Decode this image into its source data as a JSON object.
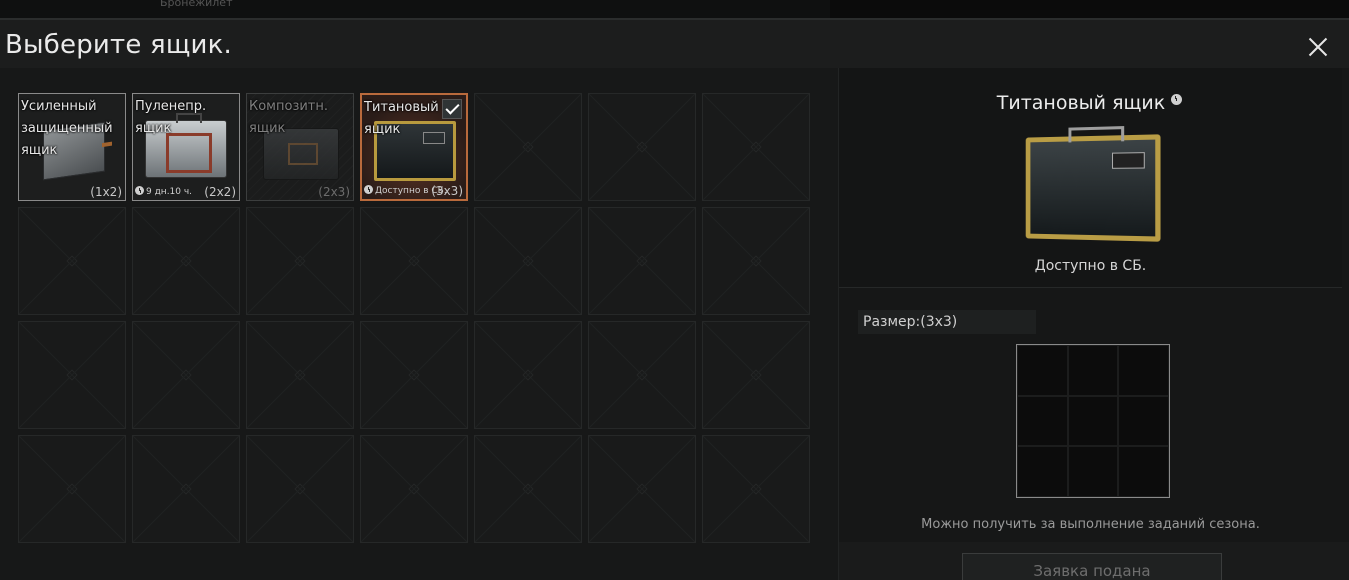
{
  "background": {
    "top_text": "Бронежилет"
  },
  "dialog": {
    "title": "Выберите ящик."
  },
  "cases": [
    {
      "name": "Усиленный защищенный ящик",
      "size": "(1x2)",
      "timer": "",
      "state": "available"
    },
    {
      "name": "Пуленепр. ящик",
      "size": "(2x2)",
      "timer": "9 дн.10 ч.",
      "state": "timed"
    },
    {
      "name": "Композитн. ящик",
      "size": "(2x3)",
      "timer": "",
      "state": "locked"
    },
    {
      "name": "Титановый ящик",
      "size": "(3x3)",
      "timer": "Доступно в СБ.",
      "state": "selected"
    }
  ],
  "grid": {
    "columns": 7,
    "rows": 4
  },
  "detail": {
    "title": "Титановый ящик",
    "availability": "Доступно в СБ.",
    "size_label": "Размер:(3x3)",
    "size_cols": 3,
    "size_rows": 3,
    "hint": "Можно получить за выполнение заданий сезона.",
    "button_label": "Заявка подана"
  },
  "colors": {
    "selected_border": "#b96a3c",
    "gold_frame": "#b99d45",
    "background": "#171818"
  }
}
